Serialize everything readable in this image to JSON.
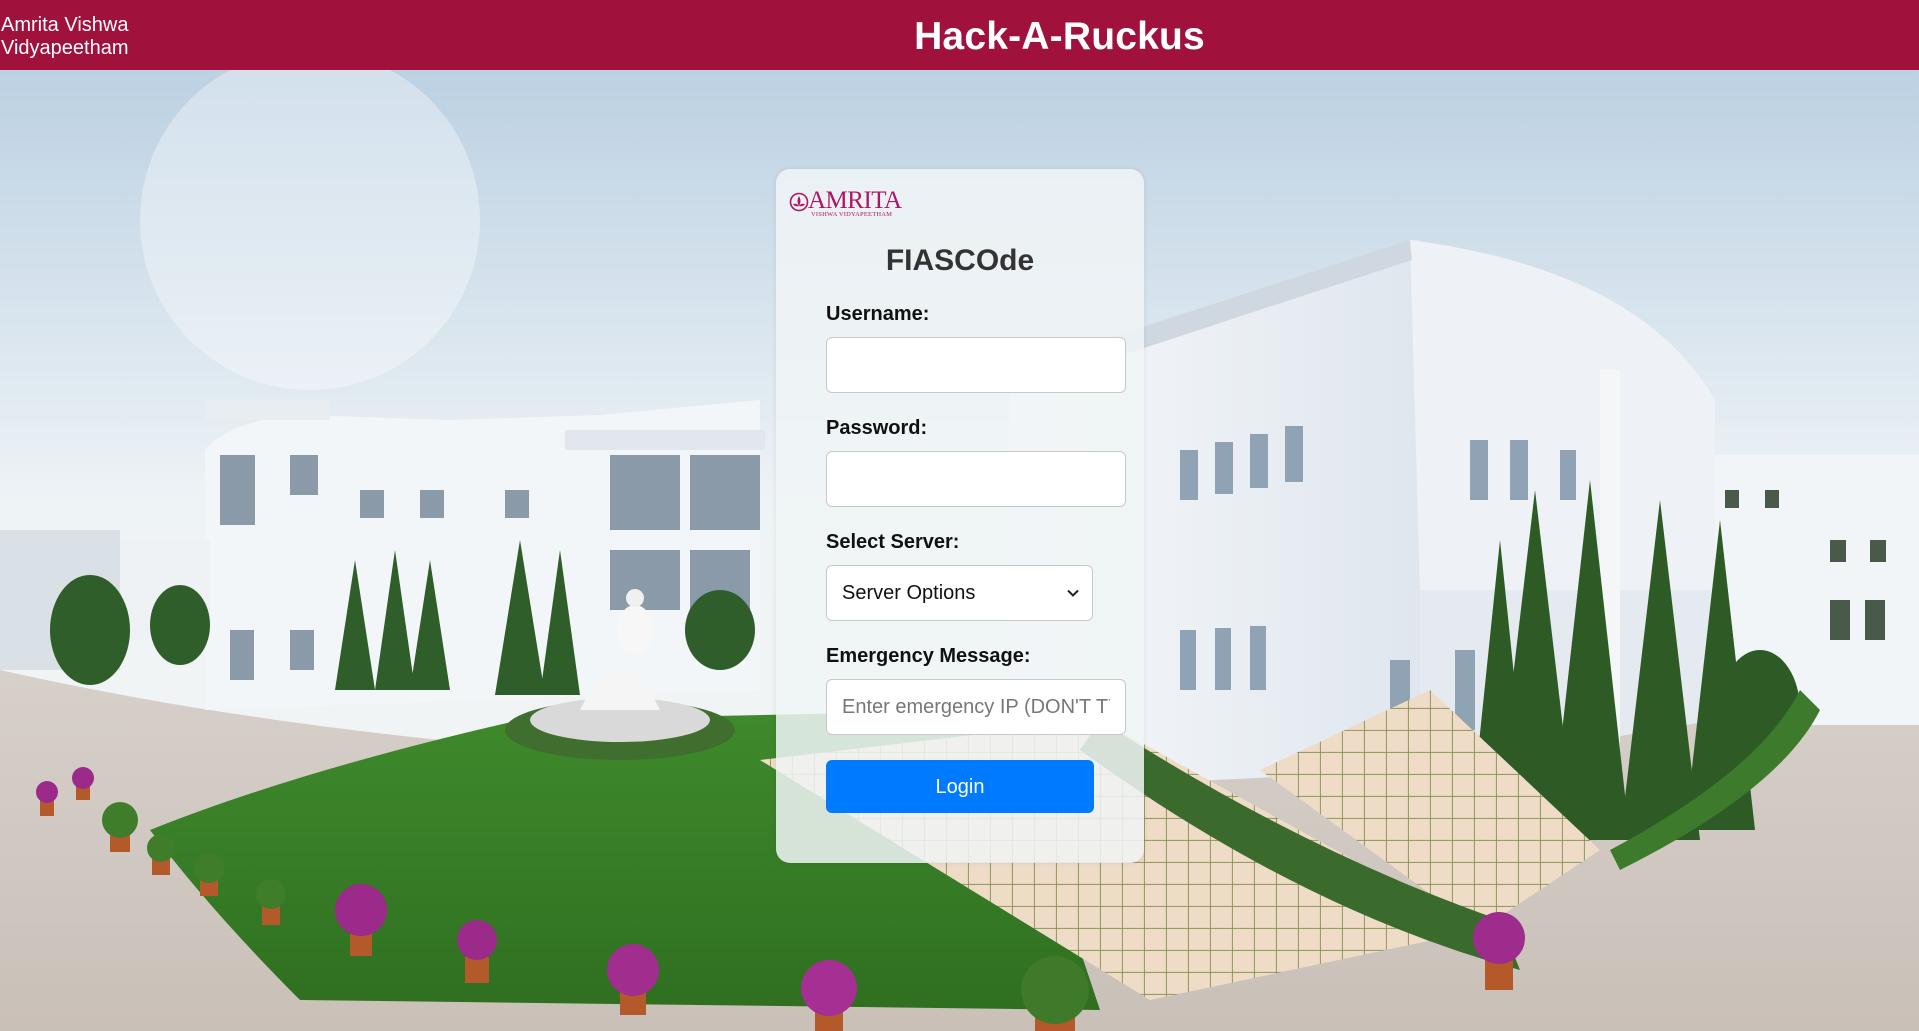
{
  "header": {
    "org_name": "Amrita Vishwa Vidyapeetham",
    "title": "Hack-A-Ruckus"
  },
  "login_card": {
    "logo": {
      "word": "AMRITA",
      "subtitle": "VISHWA VIDYAPEETHAM"
    },
    "title": "FIASCOde",
    "username": {
      "label": "Username:",
      "value": "",
      "placeholder": ""
    },
    "password": {
      "label": "Password:",
      "value": "",
      "placeholder": ""
    },
    "server": {
      "label": "Select Server:",
      "selected": "Server Options"
    },
    "emergency": {
      "label": "Emergency Message:",
      "value": "",
      "placeholder": "Enter emergency IP (DON'T TYPE)"
    },
    "login_label": "Login"
  },
  "colors": {
    "header_bg": "#a0113c",
    "login_button": "#007bff",
    "logo": "#b01463"
  },
  "icons": {
    "logo_mark": "lotus-emblem-icon",
    "select_chevron": "chevron-down-icon"
  }
}
